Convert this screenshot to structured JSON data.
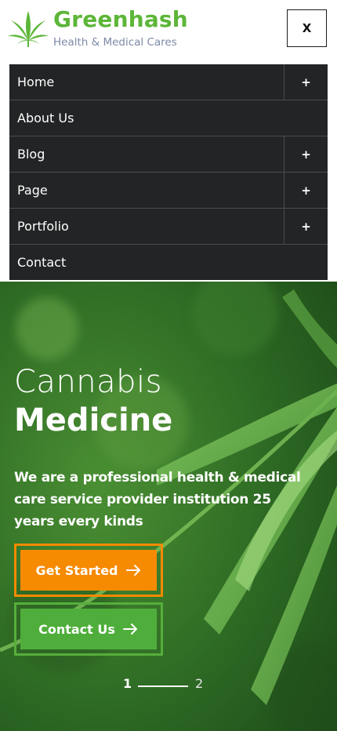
{
  "header": {
    "brand_name": "Greenhash",
    "tagline": "Health & Medical Cares",
    "close_label": "X",
    "logo_icon": "cannabis-leaf-icon",
    "brand_color": "#5cb638"
  },
  "menu": {
    "items": [
      {
        "label": "Home",
        "has_submenu": true,
        "toggle": "+"
      },
      {
        "label": "About Us",
        "has_submenu": false
      },
      {
        "label": "Blog",
        "has_submenu": true,
        "toggle": "+"
      },
      {
        "label": "Page",
        "has_submenu": true,
        "toggle": "+"
      },
      {
        "label": "Portfolio",
        "has_submenu": true,
        "toggle": "+"
      },
      {
        "label": "Contact",
        "has_submenu": false
      }
    ],
    "background": "#232425"
  },
  "hero": {
    "title_light": "Cannabis",
    "title_bold": "Medicine",
    "description": "We are a professional health & medical care service provider institution 25 years every kinds",
    "primary_button": {
      "label": "Get Started",
      "icon": "arrow-right-icon",
      "color": "#f68a00"
    },
    "secondary_button": {
      "label": "Contact Us",
      "icon": "arrow-right-icon",
      "color": "#4fae3b"
    },
    "pager": {
      "current": "1",
      "next": "2"
    }
  }
}
